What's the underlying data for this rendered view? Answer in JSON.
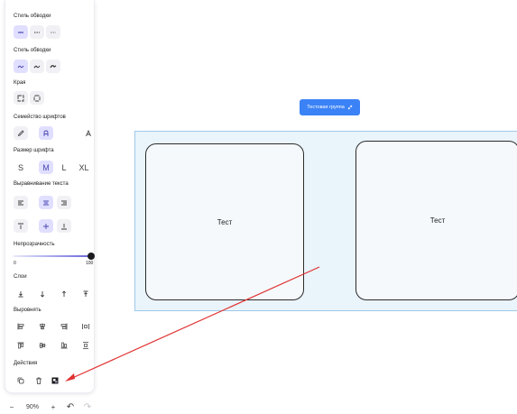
{
  "panel": {
    "stroke_style_title": "Стиль обводки",
    "stroke_style_options": [
      "solid",
      "dashed",
      "dotted"
    ],
    "sloppiness_title": "Стиль обводки",
    "sloppiness_options": [
      "architect",
      "artist",
      "cartoonist"
    ],
    "edges_title": "Края",
    "edges_options": [
      "sharp",
      "round"
    ],
    "font_family_title": "Семейство шрифтов",
    "font_family_options": [
      "hand-drawn",
      "normal",
      "code"
    ],
    "font_size_title": "Размер шрифта",
    "font_sizes": [
      "S",
      "M",
      "L",
      "XL"
    ],
    "text_align_title": "Выравнивание текста",
    "text_align_options": [
      "left",
      "center",
      "right"
    ],
    "vertical_align_options": [
      "top",
      "middle",
      "bottom"
    ],
    "opacity_title": "Непрозрачность",
    "opacity": {
      "min": "0",
      "max": "100",
      "value": 100
    },
    "layers_title": "Слои",
    "layers_options": [
      "send-to-back",
      "send-backward",
      "bring-forward",
      "bring-to-front"
    ],
    "align_title": "Выровнять",
    "align_options": [
      "align-left",
      "align-center-horizontal",
      "align-right",
      "distribute-horizontal",
      "align-top",
      "align-center-vertical",
      "align-bottom",
      "distribute-vertical"
    ],
    "actions_title": "Действия",
    "actions_options": [
      "duplicate",
      "delete",
      "group"
    ]
  },
  "zoom": {
    "minus": "−",
    "value": "90%",
    "plus": "+",
    "undo": "↶",
    "redo": "↷"
  },
  "canvas": {
    "group_badge": "Тестовая группа",
    "card_left_text": "Тест",
    "card_right_text": "Тест",
    "accent_color": "#3b82f6",
    "arrow_color": "#e03131"
  }
}
